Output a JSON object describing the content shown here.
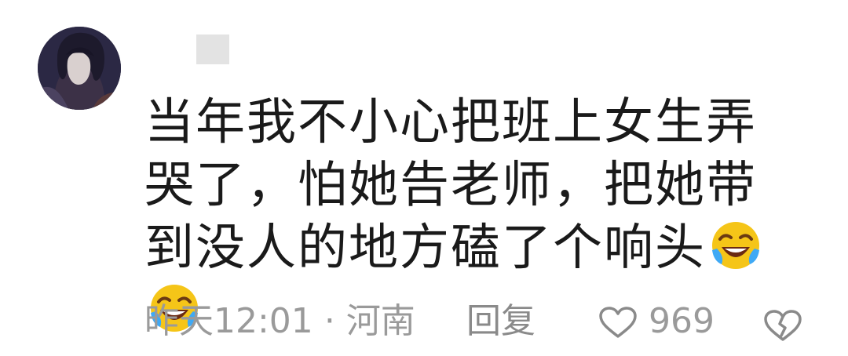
{
  "comment": {
    "text": "当年我不小心把班上女生弄哭了，怕她告老师，把她带到没人的地方磕了个响头",
    "emoji": [
      "laugh-cry-emoji",
      "laugh-cry-emoji"
    ],
    "time": "昨天12:01",
    "separator": "·",
    "location": "河南",
    "reply_label": "回复",
    "like_count": "969"
  },
  "colors": {
    "text": "#1a1a1a",
    "meta": "#9a9a9a",
    "emoji_face": "#f5c518"
  },
  "icons": {
    "like": "heart-outline-icon",
    "dislike": "broken-heart-icon"
  }
}
